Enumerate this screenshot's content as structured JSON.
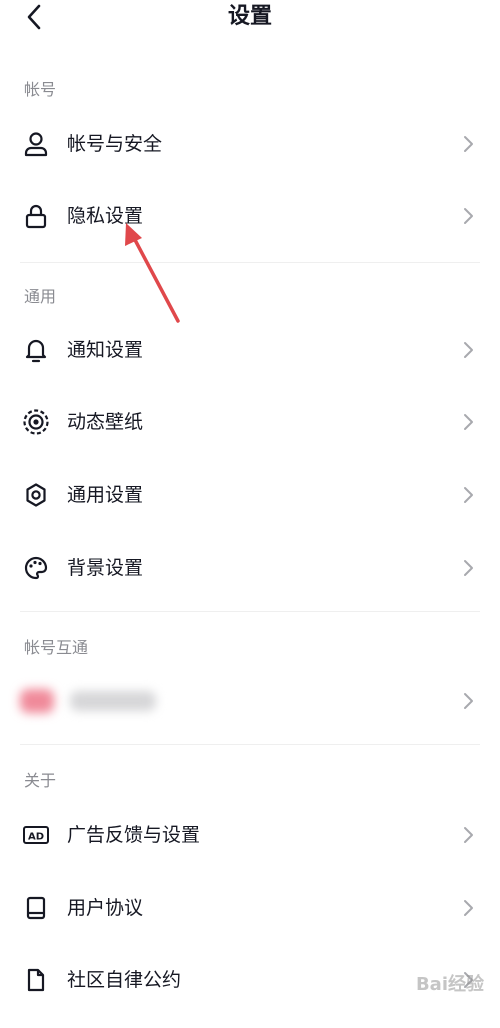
{
  "nav": {
    "title": "设置"
  },
  "sections": {
    "account": {
      "title": "帐号",
      "items": [
        {
          "label": "帐号与安全"
        },
        {
          "label": "隐私设置"
        }
      ]
    },
    "general": {
      "title": "通用",
      "items": [
        {
          "label": "通知设置"
        },
        {
          "label": "动态壁纸"
        },
        {
          "label": "通用设置"
        },
        {
          "label": "背景设置"
        }
      ]
    },
    "interop": {
      "title": "帐号互通"
    },
    "about": {
      "title": "关于",
      "items": [
        {
          "label": "广告反馈与设置"
        },
        {
          "label": "用户协议"
        },
        {
          "label": "社区自律公约"
        }
      ]
    }
  },
  "icons": {
    "back": "chevron-left-icon",
    "account_security": "user-icon",
    "privacy": "lock-icon",
    "notifications": "bell-icon",
    "live_wallpaper": "target-icon",
    "general_settings": "gear-icon",
    "background": "palette-icon",
    "ad": "ad-badge-icon",
    "user_agreement": "book-icon",
    "community": "document-icon"
  },
  "colors": {
    "text": "#161823",
    "section_title": "#8a8b91",
    "chevron": "#a8a9ae",
    "annotation_arrow": "#e0484b"
  },
  "watermark": "Bai经验"
}
